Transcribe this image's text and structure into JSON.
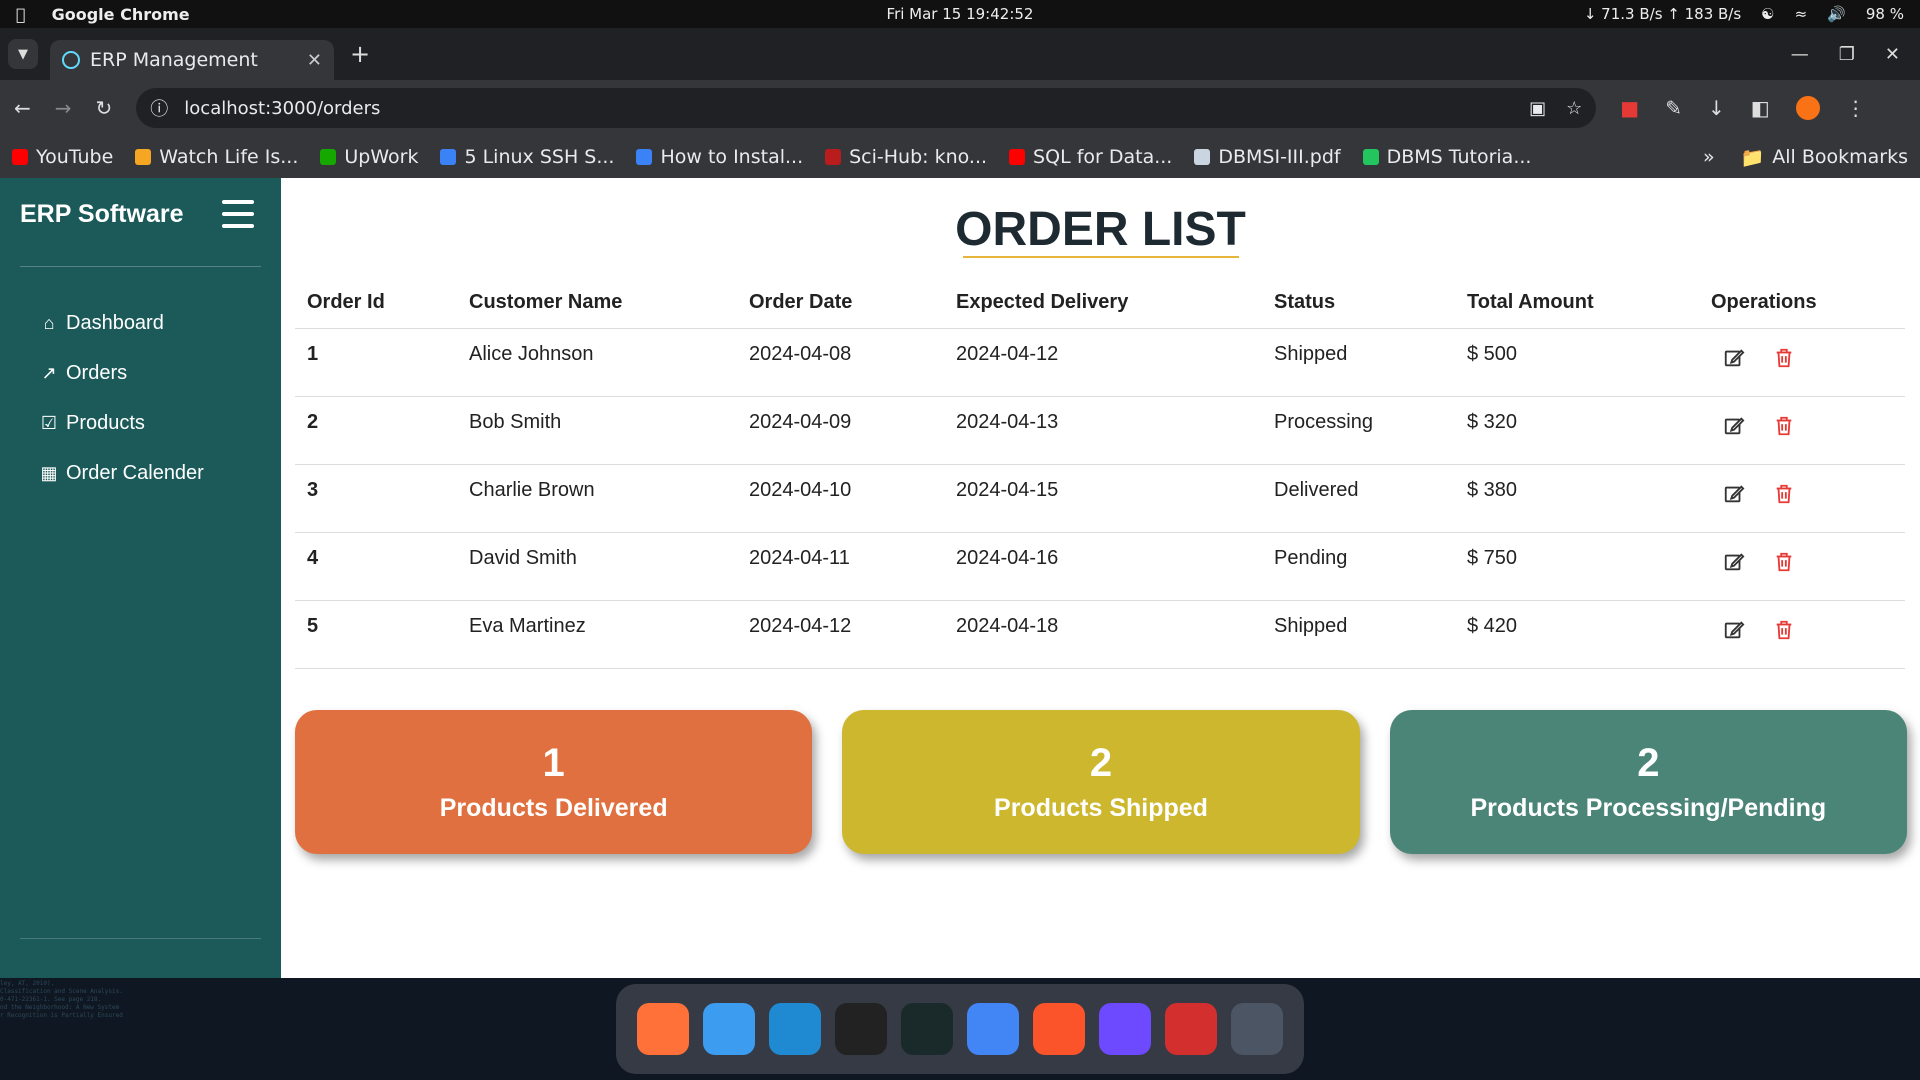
{
  "os": {
    "app_name": "Google Chrome",
    "datetime": "Fri Mar 15  19:42:52",
    "network": "↓ 71.3 B/s ↑ 183 B/s",
    "battery": "98 %"
  },
  "browser": {
    "tab_title": "ERP Management",
    "url": "localhost:3000/orders",
    "bookmarks": [
      {
        "label": "YouTube",
        "color": "#ff0000"
      },
      {
        "label": "Watch Life Is...",
        "color": "#f5a623"
      },
      {
        "label": "UpWork",
        "color": "#14a800"
      },
      {
        "label": "5 Linux SSH S...",
        "color": "#3b82f6"
      },
      {
        "label": "How to Instal...",
        "color": "#3b82f6"
      },
      {
        "label": "Sci-Hub: kno...",
        "color": "#b91c1c"
      },
      {
        "label": "SQL for Data...",
        "color": "#ff0000"
      },
      {
        "label": "DBMSI-III.pdf",
        "color": "#cbd5e1"
      },
      {
        "label": "DBMS Tutoria...",
        "color": "#22c55e"
      }
    ],
    "all_bookmarks": "All Bookmarks"
  },
  "sidebar": {
    "brand": "ERP Software",
    "items": [
      {
        "label": "Dashboard",
        "icon": "home-icon"
      },
      {
        "label": "Orders",
        "icon": "chart-line-icon"
      },
      {
        "label": "Products",
        "icon": "clipboard-icon"
      },
      {
        "label": "Order Calender",
        "icon": "calendar-icon"
      }
    ]
  },
  "page": {
    "title": "ORDER LIST",
    "columns": [
      "Order Id",
      "Customer Name",
      "Order Date",
      "Expected Delivery",
      "Status",
      "Total Amount",
      "Operations"
    ],
    "orders": [
      {
        "id": "1",
        "customer": "Alice Johnson",
        "order_date": "2024-04-08",
        "delivery": "2024-04-12",
        "status": "Shipped",
        "amount": "$ 500"
      },
      {
        "id": "2",
        "customer": "Bob Smith",
        "order_date": "2024-04-09",
        "delivery": "2024-04-13",
        "status": "Processing",
        "amount": "$ 320"
      },
      {
        "id": "3",
        "customer": "Charlie Brown",
        "order_date": "2024-04-10",
        "delivery": "2024-04-15",
        "status": "Delivered",
        "amount": "$ 380"
      },
      {
        "id": "4",
        "customer": "David Smith",
        "order_date": "2024-04-11",
        "delivery": "2024-04-16",
        "status": "Pending",
        "amount": "$ 750"
      },
      {
        "id": "5",
        "customer": "Eva Martinez",
        "order_date": "2024-04-12",
        "delivery": "2024-04-18",
        "status": "Shipped",
        "amount": "$ 420"
      }
    ],
    "cards": [
      {
        "value": "1",
        "label": "Products Delivered",
        "color": "#e0703f"
      },
      {
        "value": "2",
        "label": "Products Shipped",
        "color": "#cdb72f"
      },
      {
        "value": "2",
        "label": "Products Processing/Pending",
        "color": "#4a8577"
      }
    ]
  },
  "colors": {
    "sidebar_bg": "#1c5a5a",
    "title_underline": "#e5b53c",
    "delete_icon": "#e53935"
  },
  "dock": [
    {
      "name": "firefox-icon",
      "color": "#ff7139"
    },
    {
      "name": "finder-icon",
      "color": "#3b9cf0"
    },
    {
      "name": "vscode-icon",
      "color": "#1f8ad2"
    },
    {
      "name": "terminal-icon",
      "color": "#222"
    },
    {
      "name": "system-monitor-icon",
      "color": "#1a2a2a"
    },
    {
      "name": "chrome-icon",
      "color": "#4285f4"
    },
    {
      "name": "brave-icon",
      "color": "#fb542b"
    },
    {
      "name": "proton-vpn-icon",
      "color": "#6d4aff"
    },
    {
      "name": "acrobat-icon",
      "color": "#d32f2f"
    },
    {
      "name": "app-grid-icon",
      "color": "#4b5563"
    }
  ]
}
